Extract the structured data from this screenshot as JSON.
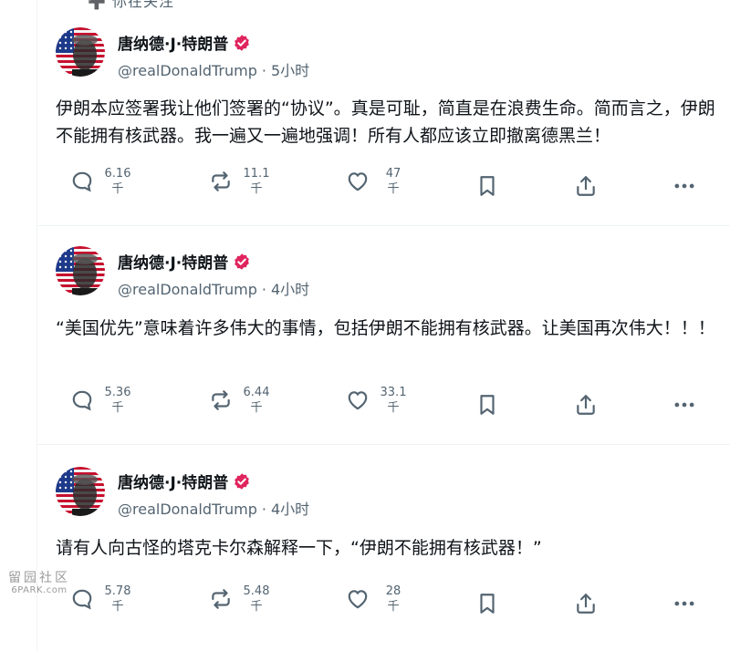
{
  "top_fragment": "➕ 你在关注",
  "author": {
    "display_name": "唐纳德·J·特朗普",
    "handle": "@realDonaldTrump"
  },
  "colors": {
    "verified": "#e0245e",
    "text": "#0f1419",
    "muted": "#536471",
    "divider": "#eff3f4"
  },
  "posts": [
    {
      "time": "5小时",
      "text": "伊朗本应签署我让他们签署的“协议”。真是可耻，简直是在浪费生命。简而言之，伊朗不能拥有核武器。我一遍又一遍地强调！所有人都应该立即撤离德黑兰！",
      "replies": {
        "num": "6.16",
        "unit": "千"
      },
      "reposts": {
        "num": "11.1",
        "unit": "千"
      },
      "likes": {
        "num": "47",
        "unit": "千"
      }
    },
    {
      "time": "4小时",
      "text": "“美国优先”意味着许多伟大的事情，包括伊朗不能拥有核武器。让美国再次伟大！！！",
      "replies": {
        "num": "5.36",
        "unit": "千"
      },
      "reposts": {
        "num": "6.44",
        "unit": "千"
      },
      "likes": {
        "num": "33.1",
        "unit": "千"
      }
    },
    {
      "time": "4小时",
      "text": "请有人向古怪的塔克卡尔森解释一下，“伊朗不能拥有核武器！”",
      "replies": {
        "num": "5.78",
        "unit": "千"
      },
      "reposts": {
        "num": "5.48",
        "unit": "千"
      },
      "likes": {
        "num": "28",
        "unit": "千"
      }
    }
  ],
  "icons": {
    "reply": "reply-icon",
    "repost": "repost-icon",
    "like": "heart-icon",
    "bookmark": "bookmark-icon",
    "share": "share-icon",
    "more": "more-icon"
  },
  "watermark": {
    "top": "留园社区",
    "bottom": "6PARK.com"
  }
}
